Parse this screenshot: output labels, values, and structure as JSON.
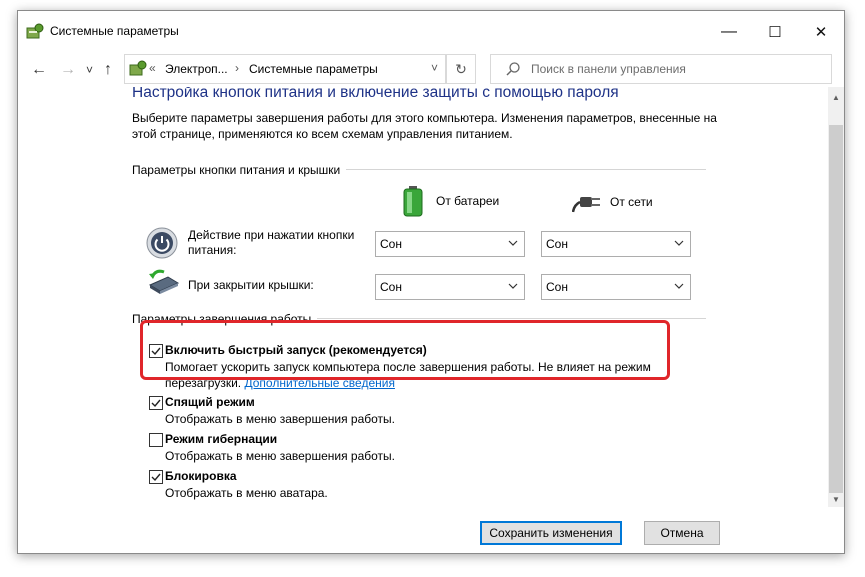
{
  "window": {
    "title": "Системные параметры"
  },
  "window_controls": {
    "minimize": "—",
    "maximize": "☐",
    "close": "✕"
  },
  "nav": {
    "back": "←",
    "forward": "→",
    "recent": "˅",
    "up": "↑",
    "breadcrumb": {
      "root": "«",
      "item1": "Электроп...",
      "sep": "›",
      "item2": "Системные параметры",
      "dropdown": "˅"
    },
    "refresh": "↻",
    "search_placeholder": "Поиск в панели управления"
  },
  "page": {
    "heading": "Настройка кнопок питания и включение защиты с помощью пароля",
    "description": "Выберите параметры завершения работы для этого компьютера. Изменения параметров, внесенные на этой странице, применяются ко всем схемам управления питанием."
  },
  "power_buttons": {
    "group_label": "Параметры кнопки питания и крышки",
    "col_battery": "От батареи",
    "col_ac": "От сети",
    "rows": [
      {
        "label": "Действие при нажатии кнопки питания:",
        "battery": "Сон",
        "ac": "Сон"
      },
      {
        "label": "При закрытии крышки:",
        "battery": "Сон",
        "ac": "Сон"
      }
    ]
  },
  "shutdown": {
    "group_label": "Параметры завершения работы",
    "options": [
      {
        "title": "Включить быстрый запуск (рекомендуется)",
        "desc": "Помогает ускорить запуск компьютера после завершения работы. Не влияет на режим",
        "desc2": "перезагрузки.",
        "link": "Дополнительные сведения",
        "checked": true
      },
      {
        "title": "Спящий режим",
        "desc": "Отображать в меню завершения работы.",
        "checked": true
      },
      {
        "title": "Режим гибернации",
        "desc": "Отображать в меню завершения работы.",
        "checked": false
      },
      {
        "title": "Блокировка",
        "desc": "Отображать в меню аватара.",
        "checked": true
      }
    ]
  },
  "footer": {
    "save": "Сохранить изменения",
    "cancel": "Отмена"
  },
  "colors": {
    "heading": "#1e3287",
    "link": "#0066cc",
    "highlight": "#e0262a",
    "primary_border": "#0078d7"
  }
}
